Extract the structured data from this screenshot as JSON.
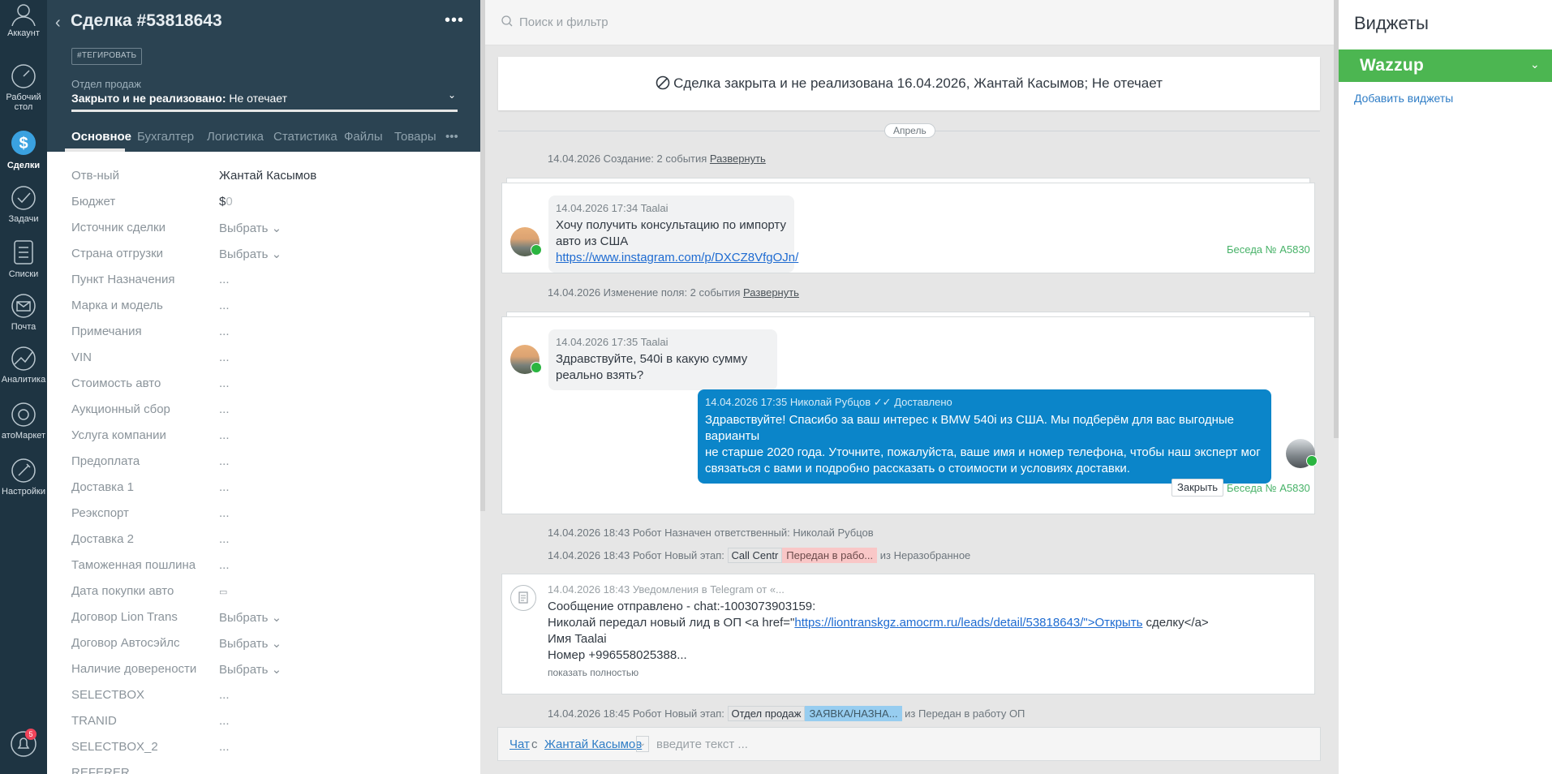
{
  "nav": {
    "items": [
      {
        "label": "Аккаунт",
        "icon": "account-icon"
      },
      {
        "label": "Рабочий\nстол",
        "icon": "dashboard-icon"
      },
      {
        "label": "Сделки",
        "icon": "deals-icon"
      },
      {
        "label": "Задачи",
        "icon": "tasks-icon"
      },
      {
        "label": "Списки",
        "icon": "lists-icon"
      },
      {
        "label": "Почта",
        "icon": "mail-icon"
      },
      {
        "label": "Аналитика",
        "icon": "analytics-icon"
      },
      {
        "label": "атоМаркет",
        "icon": "market-icon"
      },
      {
        "label": "Настройки",
        "icon": "settings-icon"
      }
    ],
    "notifications_badge": "5"
  },
  "lead": {
    "title": "Сделка #53818643",
    "tag_button": "#ТЕГИРОВАТЬ",
    "pipeline": "Отдел продаж",
    "status_bold": "Закрыто и не реализовано:",
    "status_reason": " Не отечает",
    "tabs": [
      "Основное",
      "Бухгалтерия",
      "Логистика",
      "Статистика",
      "Файлы",
      "Товары"
    ],
    "fields": [
      {
        "label": "Отв-ный",
        "value": "Жантай Касымов"
      },
      {
        "label": "Бюджет",
        "value": "$",
        "value_muted": "0"
      },
      {
        "label": "Источник сделки",
        "value": "Выбрать ⌄"
      },
      {
        "label": "Страна отгрузки",
        "value": "Выбрать ⌄"
      },
      {
        "label": "Пункт Назначения",
        "value": "..."
      },
      {
        "label": "Марка и модель",
        "value": "..."
      },
      {
        "label": "Примечания",
        "value": "..."
      },
      {
        "label": "VIN",
        "value": "..."
      },
      {
        "label": "Стоимость авто",
        "value": "..."
      },
      {
        "label": "Аукционный сбор",
        "value": "..."
      },
      {
        "label": "Услуга компании",
        "value": "..."
      },
      {
        "label": "Предоплата",
        "value": "..."
      },
      {
        "label": "Доставка 1",
        "value": "..."
      },
      {
        "label": "Реэкспорт",
        "value": "..."
      },
      {
        "label": "Доставка 2",
        "value": "..."
      },
      {
        "label": "Таможенная пошлина",
        "value": "..."
      },
      {
        "label": "Дата покупки авто",
        "value": "▭"
      },
      {
        "label": "Договор Lion Trans",
        "value": "Выбрать ⌄"
      },
      {
        "label": "Договор Автосэйлс",
        "value": "Выбрать ⌄"
      },
      {
        "label": "Наличие доверености",
        "value": "Выбрать ⌄"
      },
      {
        "label": "SELECTBOX",
        "value": "..."
      },
      {
        "label": "TRANID",
        "value": "..."
      },
      {
        "label": "SELECTBOX_2",
        "value": "..."
      },
      {
        "label": "REFERER",
        "value": ""
      }
    ]
  },
  "feed": {
    "search_placeholder": "Поиск и фильтр",
    "closed_banner": "Сделка закрыта и не реализована 16.04.2026, Жантай Касымов; Не отечает",
    "month": "Апрель",
    "events": {
      "e1_text": "14.04.2026 Создание: 2 события ",
      "e1_link": "Развернуть",
      "e2_text": "14.04.2026 Изменение поля: 2 события ",
      "e2_link": "Развернуть",
      "e3": "14.04.2026 18:43 Робот Назначен ответственный: Николай Рубцов",
      "e4_prefix": "14.04.2026 18:43 Робот Новый этап: ",
      "e4_chip1": "Call Centr",
      "e4_chip2": "Передан в рабо...",
      "e4_suffix": " из Неразобранное",
      "e5_prefix": "14.04.2026 18:45 Робот Новый этап: ",
      "e5_chip1": "Отдел продаж",
      "e5_chip2": "ЗАЯВКА/НАЗНА...",
      "e5_suffix": " из Передан в работу ОП"
    },
    "msg1": {
      "meta": "14.04.2026 17:34 Taalai",
      "text": "Хочу получить консультацию по импорту авто из США",
      "link": "https://www.instagram.com/p/DXCZ8VfgOJn/",
      "conversation": "Беседа № A5830"
    },
    "msg2": {
      "meta": "14.04.2026 17:35 Taalai",
      "text": "Здравствуйте, 540i в какую сумму реально взять?"
    },
    "msg3": {
      "meta": "14.04.2026 17:35 Николай Рубцов",
      "status": "Доставлено",
      "line1": "Здравствуйте! Спасибо за ваш интерес к BMW 540i из США. Мы подберём для вас выгодные варианты",
      "line2": "не старше 2020 года. Уточните, пожалуйста, ваше имя и номер телефона, чтобы наш эксперт мог",
      "line3": "связаться с вами и подробно рассказать о стоимости и условиях доставки.",
      "close_button": "Закрыть",
      "conversation": "Беседа № A5830"
    },
    "note": {
      "meta": "14.04.2026 18:43 Уведомления в Telegram от «...",
      "line1": "Сообщение отправлено - chat:-1003073903159:",
      "line2_pre": "Николай передал новый лид в ОП <a href=\"",
      "line2_link": "https://liontranskgz.amocrm.ru/leads/detail/53818643/\">Открыть",
      "line2_post": " сделку</a>",
      "line3": "Имя Taalai",
      "line4": "Номер +996558025388...",
      "expand": "показать полностью"
    },
    "chat": {
      "mode": "Чат",
      "with": " с ",
      "contact": "Жантай Касымов",
      "placeholder": "введите текст ..."
    }
  },
  "widgets": {
    "title": "Виджеты",
    "wazzup": "Wazzup",
    "add": "Добавить виджеты"
  },
  "colors": {
    "nav_bg": "#1e3442",
    "header_bg": "#2b4352",
    "outgoing_bubble": "#0b85c9",
    "wazzup_green": "#4cb651",
    "conversation_green": "#47b268"
  }
}
